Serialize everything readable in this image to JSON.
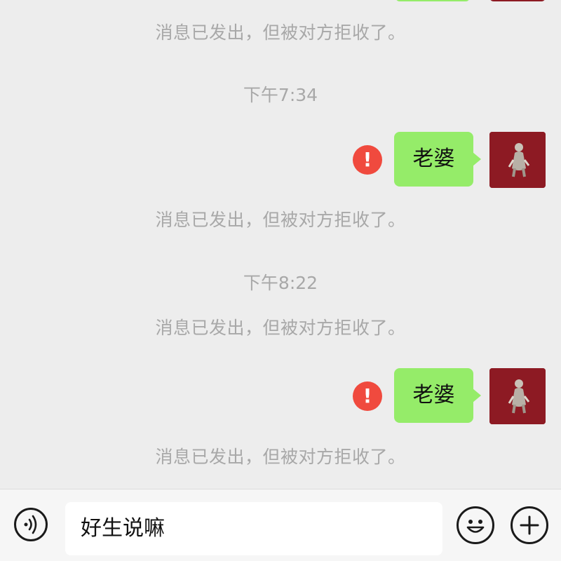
{
  "chat": {
    "items": [
      {
        "type": "notice",
        "text": "消息已发出，但被对方拒收了。"
      },
      {
        "type": "timestamp",
        "text": "下午7:34"
      },
      {
        "type": "message",
        "text": "老婆",
        "status": "rejected",
        "status_icon": "exclamation-error-icon"
      },
      {
        "type": "notice",
        "text": "消息已发出，但被对方拒收了。"
      },
      {
        "type": "timestamp",
        "text": "下午8:22"
      },
      {
        "type": "notice",
        "text": "消息已发出，但被对方拒收了。"
      },
      {
        "type": "message",
        "text": "老婆",
        "status": "rejected",
        "status_icon": "exclamation-error-icon"
      },
      {
        "type": "notice",
        "text": "消息已发出，但被对方拒收了。"
      }
    ],
    "error_glyph": "!"
  },
  "input_bar": {
    "voice_icon": "voice-icon",
    "draft_text": "好生说嘛",
    "emoji_icon": "emoji-icon",
    "more_icon": "plus-icon"
  },
  "colors": {
    "background": "#ededed",
    "bubble_green": "#95ec69",
    "error_red": "#f04a3e",
    "avatar_red": "#8d1a23",
    "notice_gray": "#a8a8a8"
  }
}
